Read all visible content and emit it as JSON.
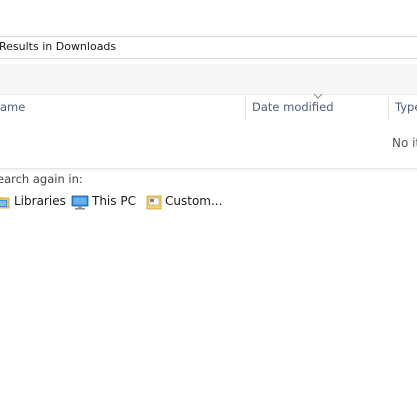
{
  "address": {
    "text": "Results in Downloads"
  },
  "columns": {
    "name": "ame",
    "date_modified": "Date modified",
    "type": "Type"
  },
  "results": {
    "empty_text": "No it"
  },
  "search_again": {
    "label": "earch again in:",
    "items": [
      {
        "label": "Libraries",
        "icon": "libraries-icon"
      },
      {
        "label": "This PC",
        "icon": "computer-icon"
      },
      {
        "label": "Custom...",
        "icon": "custom-folder-icon"
      }
    ]
  },
  "colors": {
    "header_text": "#4a5f7e",
    "toolbar_bg": "#f7f7f7",
    "folder_yellow": "#f4c542",
    "monitor_blue": "#2f8ad8"
  }
}
